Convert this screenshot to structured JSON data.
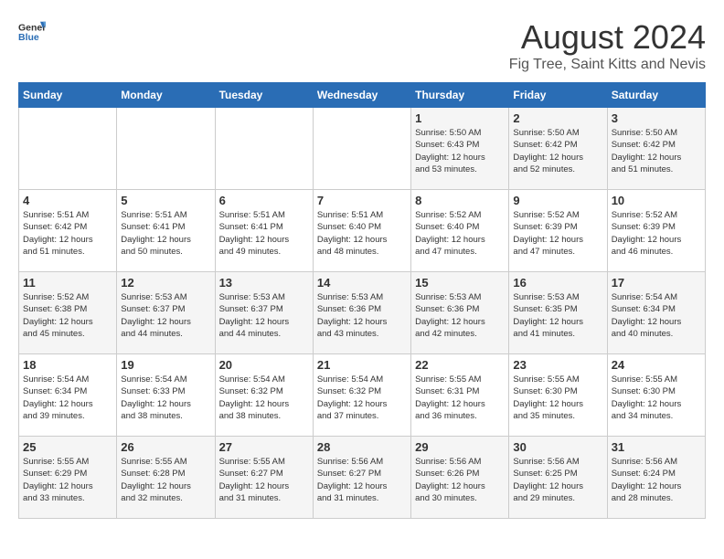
{
  "header": {
    "logo_general": "General",
    "logo_blue": "Blue",
    "main_title": "August 2024",
    "sub_title": "Fig Tree, Saint Kitts and Nevis"
  },
  "calendar": {
    "days_of_week": [
      "Sunday",
      "Monday",
      "Tuesday",
      "Wednesday",
      "Thursday",
      "Friday",
      "Saturday"
    ],
    "weeks": [
      [
        {
          "day": "",
          "info": ""
        },
        {
          "day": "",
          "info": ""
        },
        {
          "day": "",
          "info": ""
        },
        {
          "day": "",
          "info": ""
        },
        {
          "day": "1",
          "info": "Sunrise: 5:50 AM\nSunset: 6:43 PM\nDaylight: 12 hours\nand 53 minutes."
        },
        {
          "day": "2",
          "info": "Sunrise: 5:50 AM\nSunset: 6:42 PM\nDaylight: 12 hours\nand 52 minutes."
        },
        {
          "day": "3",
          "info": "Sunrise: 5:50 AM\nSunset: 6:42 PM\nDaylight: 12 hours\nand 51 minutes."
        }
      ],
      [
        {
          "day": "4",
          "info": "Sunrise: 5:51 AM\nSunset: 6:42 PM\nDaylight: 12 hours\nand 51 minutes."
        },
        {
          "day": "5",
          "info": "Sunrise: 5:51 AM\nSunset: 6:41 PM\nDaylight: 12 hours\nand 50 minutes."
        },
        {
          "day": "6",
          "info": "Sunrise: 5:51 AM\nSunset: 6:41 PM\nDaylight: 12 hours\nand 49 minutes."
        },
        {
          "day": "7",
          "info": "Sunrise: 5:51 AM\nSunset: 6:40 PM\nDaylight: 12 hours\nand 48 minutes."
        },
        {
          "day": "8",
          "info": "Sunrise: 5:52 AM\nSunset: 6:40 PM\nDaylight: 12 hours\nand 47 minutes."
        },
        {
          "day": "9",
          "info": "Sunrise: 5:52 AM\nSunset: 6:39 PM\nDaylight: 12 hours\nand 47 minutes."
        },
        {
          "day": "10",
          "info": "Sunrise: 5:52 AM\nSunset: 6:39 PM\nDaylight: 12 hours\nand 46 minutes."
        }
      ],
      [
        {
          "day": "11",
          "info": "Sunrise: 5:52 AM\nSunset: 6:38 PM\nDaylight: 12 hours\nand 45 minutes."
        },
        {
          "day": "12",
          "info": "Sunrise: 5:53 AM\nSunset: 6:37 PM\nDaylight: 12 hours\nand 44 minutes."
        },
        {
          "day": "13",
          "info": "Sunrise: 5:53 AM\nSunset: 6:37 PM\nDaylight: 12 hours\nand 44 minutes."
        },
        {
          "day": "14",
          "info": "Sunrise: 5:53 AM\nSunset: 6:36 PM\nDaylight: 12 hours\nand 43 minutes."
        },
        {
          "day": "15",
          "info": "Sunrise: 5:53 AM\nSunset: 6:36 PM\nDaylight: 12 hours\nand 42 minutes."
        },
        {
          "day": "16",
          "info": "Sunrise: 5:53 AM\nSunset: 6:35 PM\nDaylight: 12 hours\nand 41 minutes."
        },
        {
          "day": "17",
          "info": "Sunrise: 5:54 AM\nSunset: 6:34 PM\nDaylight: 12 hours\nand 40 minutes."
        }
      ],
      [
        {
          "day": "18",
          "info": "Sunrise: 5:54 AM\nSunset: 6:34 PM\nDaylight: 12 hours\nand 39 minutes."
        },
        {
          "day": "19",
          "info": "Sunrise: 5:54 AM\nSunset: 6:33 PM\nDaylight: 12 hours\nand 38 minutes."
        },
        {
          "day": "20",
          "info": "Sunrise: 5:54 AM\nSunset: 6:32 PM\nDaylight: 12 hours\nand 38 minutes."
        },
        {
          "day": "21",
          "info": "Sunrise: 5:54 AM\nSunset: 6:32 PM\nDaylight: 12 hours\nand 37 minutes."
        },
        {
          "day": "22",
          "info": "Sunrise: 5:55 AM\nSunset: 6:31 PM\nDaylight: 12 hours\nand 36 minutes."
        },
        {
          "day": "23",
          "info": "Sunrise: 5:55 AM\nSunset: 6:30 PM\nDaylight: 12 hours\nand 35 minutes."
        },
        {
          "day": "24",
          "info": "Sunrise: 5:55 AM\nSunset: 6:30 PM\nDaylight: 12 hours\nand 34 minutes."
        }
      ],
      [
        {
          "day": "25",
          "info": "Sunrise: 5:55 AM\nSunset: 6:29 PM\nDaylight: 12 hours\nand 33 minutes."
        },
        {
          "day": "26",
          "info": "Sunrise: 5:55 AM\nSunset: 6:28 PM\nDaylight: 12 hours\nand 32 minutes."
        },
        {
          "day": "27",
          "info": "Sunrise: 5:55 AM\nSunset: 6:27 PM\nDaylight: 12 hours\nand 31 minutes."
        },
        {
          "day": "28",
          "info": "Sunrise: 5:56 AM\nSunset: 6:27 PM\nDaylight: 12 hours\nand 31 minutes."
        },
        {
          "day": "29",
          "info": "Sunrise: 5:56 AM\nSunset: 6:26 PM\nDaylight: 12 hours\nand 30 minutes."
        },
        {
          "day": "30",
          "info": "Sunrise: 5:56 AM\nSunset: 6:25 PM\nDaylight: 12 hours\nand 29 minutes."
        },
        {
          "day": "31",
          "info": "Sunrise: 5:56 AM\nSunset: 6:24 PM\nDaylight: 12 hours\nand 28 minutes."
        }
      ]
    ]
  }
}
